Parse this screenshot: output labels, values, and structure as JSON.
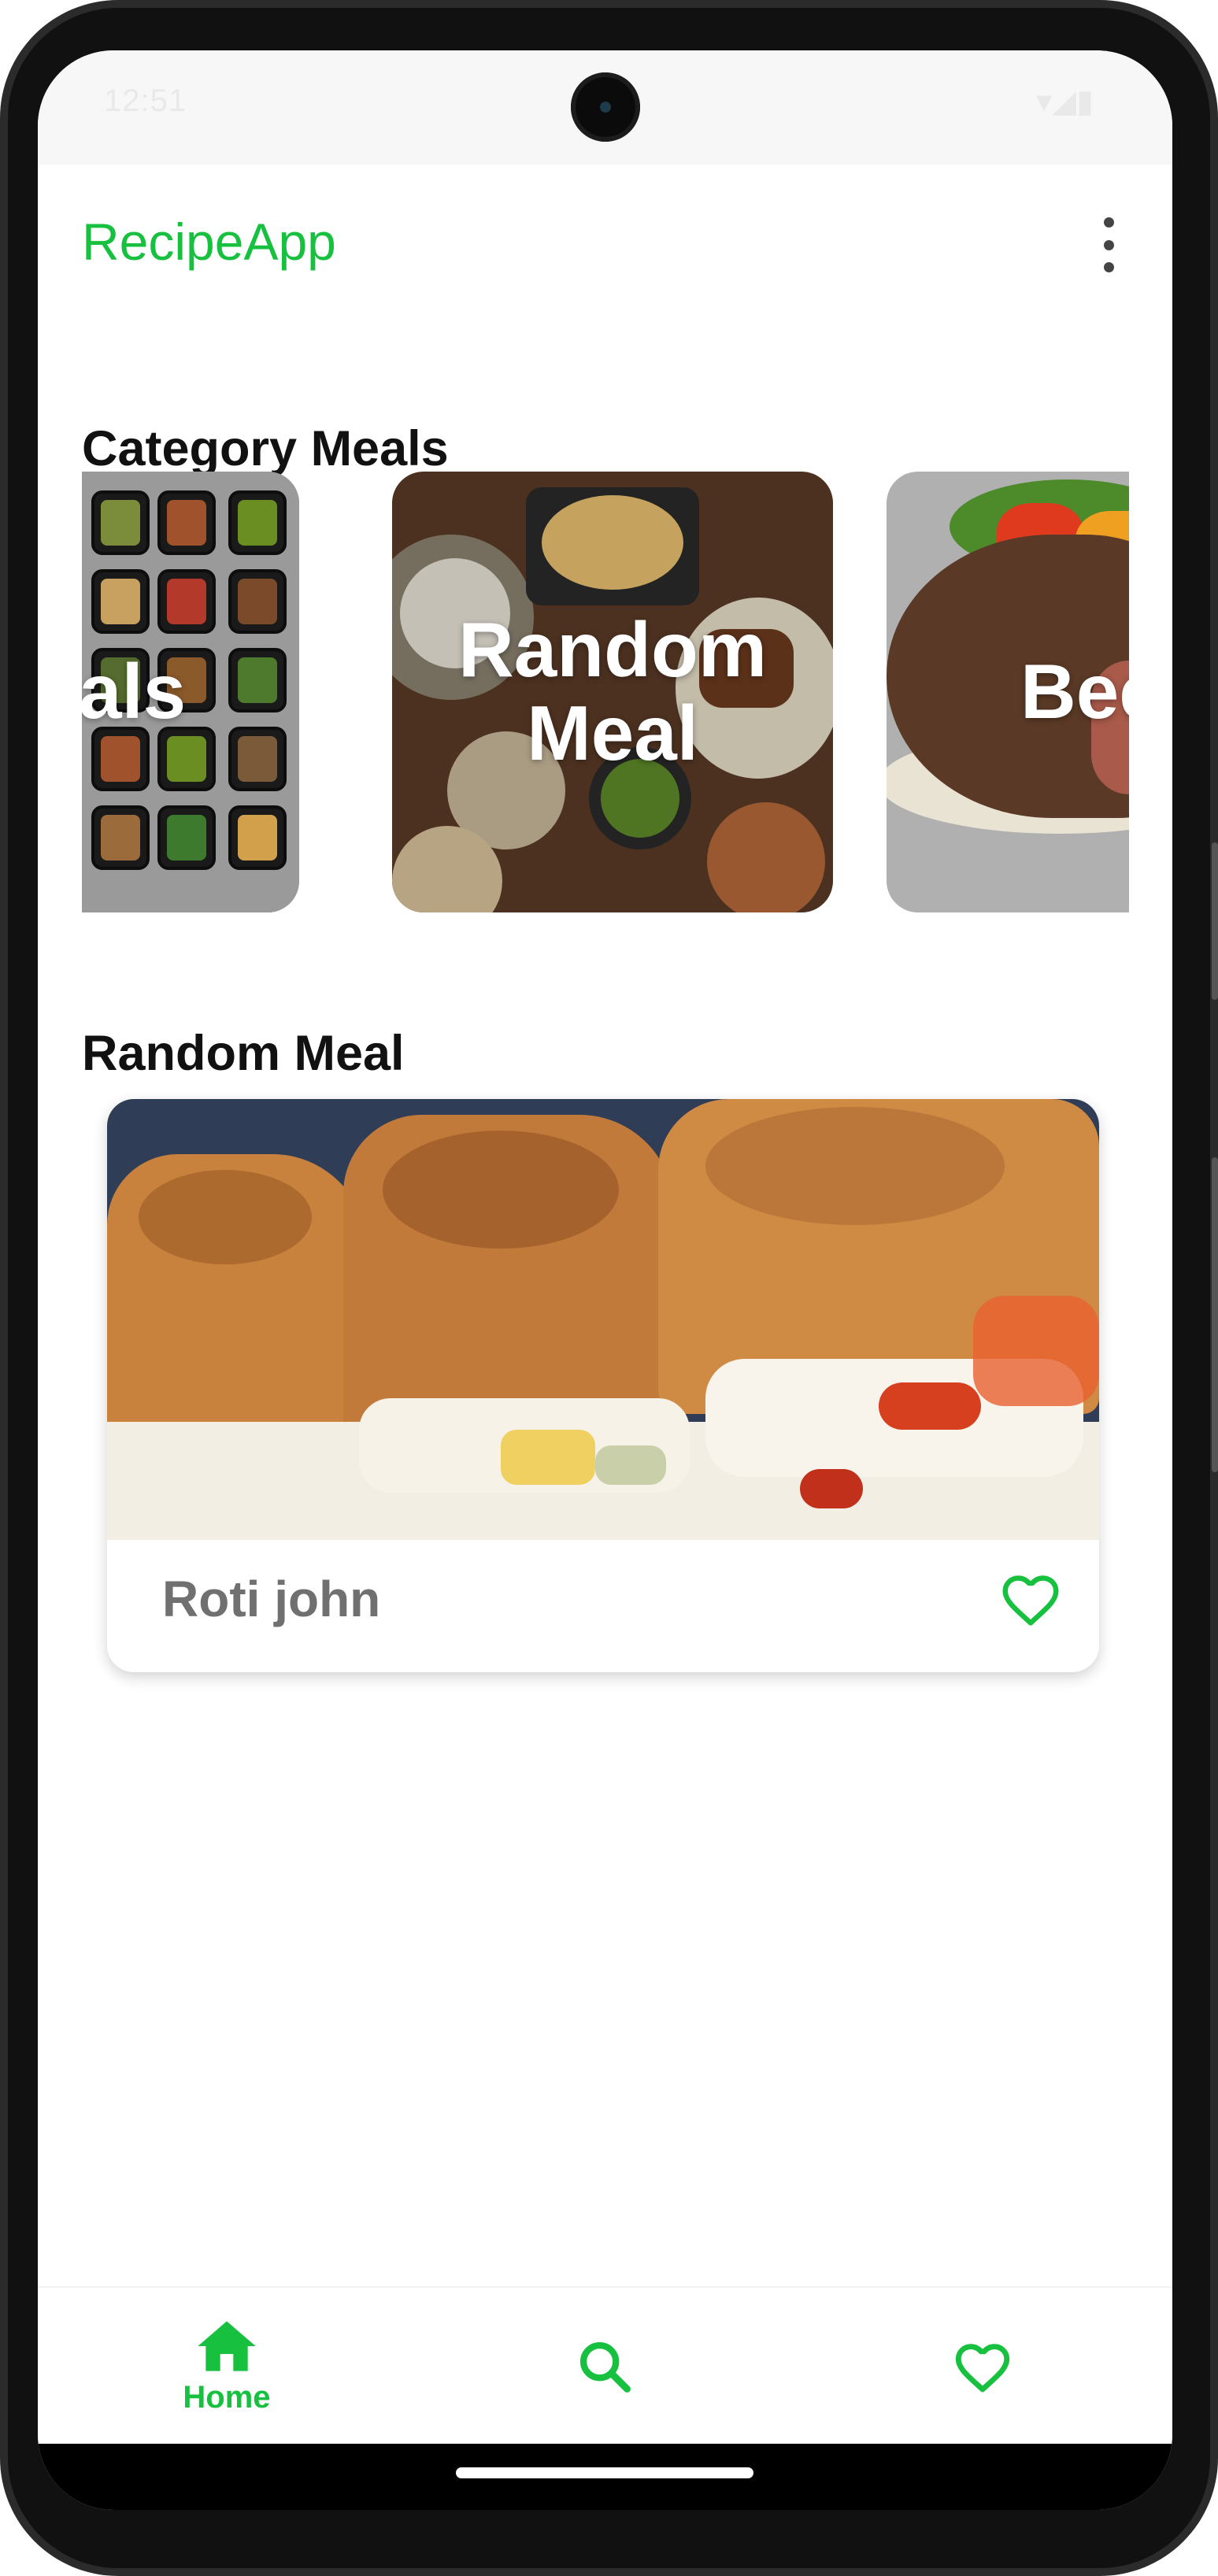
{
  "status_bar": {
    "time": "12:51",
    "icons": "▾◢▮"
  },
  "app_bar": {
    "title": "RecipeApp",
    "menu_icon": "more-vert-icon"
  },
  "sections": {
    "category_title": "Category Meals",
    "random_title": "Random Meal"
  },
  "categories": [
    {
      "label": "Meals"
    },
    {
      "label": "Random Meal"
    },
    {
      "label": "Beef"
    }
  ],
  "random_meal": {
    "name": "Roti john",
    "favorite_icon": "heart-outline-icon"
  },
  "bottom_nav": {
    "home_label": "Home",
    "search_icon": "search-icon",
    "favorites_icon": "heart-outline-icon"
  },
  "colors": {
    "accent": "#17c13f",
    "title_text": "#111111",
    "meal_name": "#707070"
  }
}
